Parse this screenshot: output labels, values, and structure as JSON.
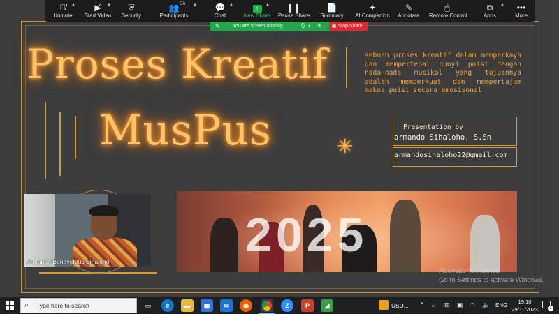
{
  "zoom_toolbar": {
    "unmute": "Unmute",
    "start_video": "Start Video",
    "security": "Security",
    "participants": "Participants",
    "participants_count": "56",
    "chat": "Chat",
    "new_share": "New Share",
    "pause_share": "Pause Share",
    "summary": "Summary",
    "ai_companion": "AI Companion",
    "annotate": "Annotate",
    "remote_control": "Remote Control",
    "apps": "Apps",
    "more": "More"
  },
  "share_status": {
    "text": "You are screen sharing",
    "stop": "Stop Share"
  },
  "slide": {
    "title_line1": "Proses Kreatif",
    "title_line2": "MusPus",
    "description": "sebuah proses kreatif dalam memperkaya dan mempertebal bunyi puisi dengan nada-nada musikal yang tujuannya adalah memperkuat dan mempertajam makna puisi secara emosisonal",
    "presentation_label": "Presentation by",
    "presenter": "armando Sihaloho, S.Sn",
    "email": "armandosihaloho22@gmail.com",
    "photo_number": "2025"
  },
  "webcam": {
    "name": "Armando Bonaventus Sihaloho"
  },
  "watermark": {
    "line1": "Activate Windows",
    "line2": "Go to Settings to activate Windows."
  },
  "taskbar": {
    "search_placeholder": "Type here to search",
    "currency": "USD...",
    "language": "ENG",
    "time": "19:10",
    "date": "29/11/2023",
    "notification_count": "1"
  },
  "colors": {
    "accent_orange": "#ffc46a",
    "zoom_green": "#22a84a",
    "stop_red": "#e0282e"
  }
}
